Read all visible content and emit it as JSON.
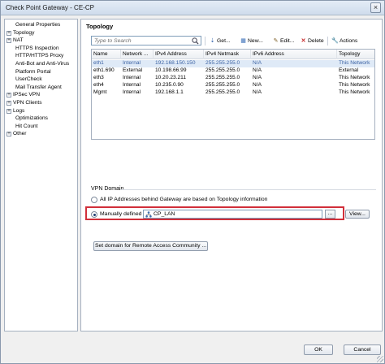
{
  "window": {
    "title": "Check Point Gateway - CE-CP",
    "close_glyph": "×"
  },
  "tree": [
    {
      "label": "General Properties",
      "expander": "",
      "child": true
    },
    {
      "label": "Topology",
      "expander": "+",
      "child": false
    },
    {
      "label": "NAT",
      "expander": "+",
      "child": false
    },
    {
      "label": "HTTPS Inspection",
      "expander": "",
      "child": true
    },
    {
      "label": "HTTP/HTTPS Proxy",
      "expander": "",
      "child": true
    },
    {
      "label": "Anti-Bot and Anti-Virus",
      "expander": "",
      "child": true
    },
    {
      "label": "Platform Portal",
      "expander": "",
      "child": true
    },
    {
      "label": "UserCheck",
      "expander": "",
      "child": true
    },
    {
      "label": "Mail Transfer Agent",
      "expander": "",
      "child": true
    },
    {
      "label": "IPSec VPN",
      "expander": "+",
      "child": false
    },
    {
      "label": "VPN Clients",
      "expander": "+",
      "child": false
    },
    {
      "label": "Logs",
      "expander": "+",
      "child": false
    },
    {
      "label": "Optimizations",
      "expander": "",
      "child": true
    },
    {
      "label": "Hit Count",
      "expander": "",
      "child": true
    },
    {
      "label": "Other",
      "expander": "+",
      "child": false
    }
  ],
  "topology": {
    "title": "Topology",
    "search_placeholder": "Type to Search",
    "toolbar": {
      "get": "Get...",
      "new": "New...",
      "edit": "Edit...",
      "delete": "Delete",
      "actions": "Actions"
    },
    "columns": [
      "Name",
      "Network ...",
      "IPv4 Address",
      "IPv4 Netmask",
      "IPv6 Address",
      "Topology"
    ],
    "rows": [
      [
        "eth1",
        "Internal",
        "192.168.150.150",
        "255.255.255.0",
        "N/A",
        "This Network"
      ],
      [
        "eth1.690",
        "External",
        "10.198.66.99",
        "255.255.255.0",
        "N/A",
        "External"
      ],
      [
        "eth3",
        "Internal",
        "10.20.23.211",
        "255.255.255.0",
        "N/A",
        "This Network"
      ],
      [
        "eth4",
        "Internal",
        "10.235.0.90",
        "255.255.255.0",
        "N/A",
        "This Network"
      ],
      [
        "Mgmt",
        "Internal",
        "192.168.1.1",
        "255.255.255.0",
        "N/A",
        "This Network"
      ]
    ],
    "selected_row": 0
  },
  "vpn_domain": {
    "title": "VPN Domain",
    "option_all": "All IP Addresses behind Gateway are based on Topology information",
    "option_manual": "Manually defined",
    "selected_option": "manual",
    "object_value": "CP_LAN",
    "browse_label": "...",
    "view_label": "View...",
    "remote_access_label": "Set domain for Remote Access Community ...",
    "highlight_color": "#d12f3a"
  },
  "footer": {
    "ok_label": "OK",
    "cancel_label": "Cancel"
  }
}
